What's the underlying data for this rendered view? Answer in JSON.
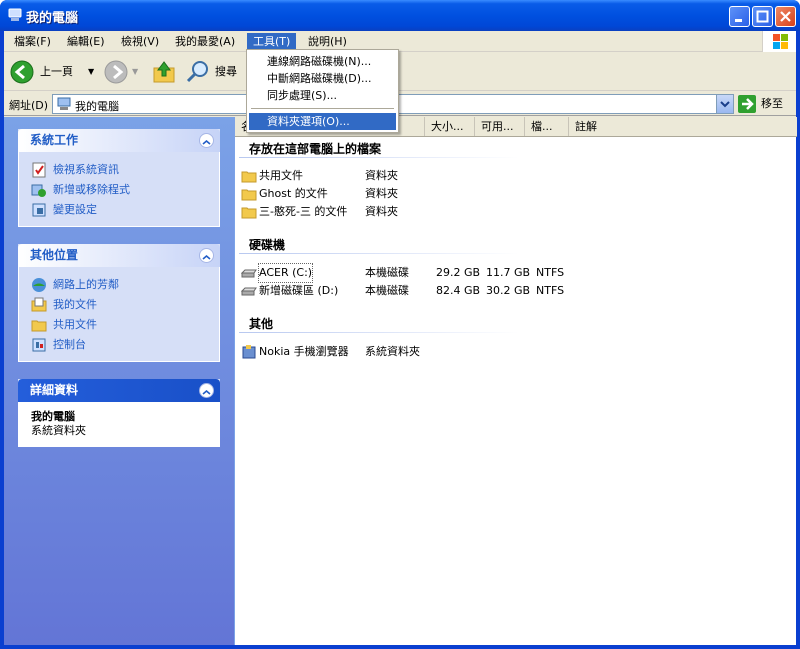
{
  "window": {
    "title": "我的電腦"
  },
  "menubar": {
    "items": [
      "檔案(F)",
      "編輯(E)",
      "檢視(V)",
      "我的最愛(A)",
      "工具(T)",
      "說明(H)"
    ],
    "active_index": 4
  },
  "tools_menu": {
    "items": [
      "連線網路磁碟機(N)...",
      "中斷網路磁碟機(D)...",
      "同步處理(S)...",
      "資料夾選項(O)..."
    ],
    "highlighted_index": 3
  },
  "toolbar": {
    "back_label": "上一頁",
    "search_label": "搜尋"
  },
  "address": {
    "label": "網址(D)",
    "value": "我的電腦",
    "go_label": "移至"
  },
  "left_pane": {
    "system_tasks": {
      "title": "系統工作",
      "items": [
        "檢視系統資訊",
        "新增或移除程式",
        "變更設定"
      ]
    },
    "other_places": {
      "title": "其他位置",
      "items": [
        "網路上的芳鄰",
        "我的文件",
        "共用文件",
        "控制台"
      ]
    },
    "details": {
      "title": "詳細資料",
      "name": "我的電腦",
      "type": "系統資料夾"
    }
  },
  "columns": [
    "名",
    "大小...",
    "可用...",
    "檔...",
    "註解"
  ],
  "groups": {
    "files": {
      "title": "存放在這部電腦上的檔案",
      "items": [
        {
          "name": "共用文件",
          "type": "資料夾"
        },
        {
          "name": "Ghost 的文件",
          "type": "資料夾"
        },
        {
          "name": "三-憨死-三 的文件",
          "type": "資料夾"
        }
      ]
    },
    "drives": {
      "title": "硬碟機",
      "items": [
        {
          "name": "ACER (C:)",
          "type": "本機磁碟",
          "size": "29.2 GB",
          "free": "11.7 GB",
          "fs": "NTFS"
        },
        {
          "name": "新增磁碟區 (D:)",
          "type": "本機磁碟",
          "size": "82.4 GB",
          "free": "30.2 GB",
          "fs": "NTFS"
        }
      ]
    },
    "other": {
      "title": "其他",
      "items": [
        {
          "name": "Nokia 手機瀏覽器",
          "type": "系統資料夾"
        }
      ]
    }
  },
  "colors": {
    "titlebar": "#0050e0",
    "menu_highlight": "#316ac5",
    "task_pane_blue": "#6375d6",
    "link_blue": "#215dc6"
  }
}
